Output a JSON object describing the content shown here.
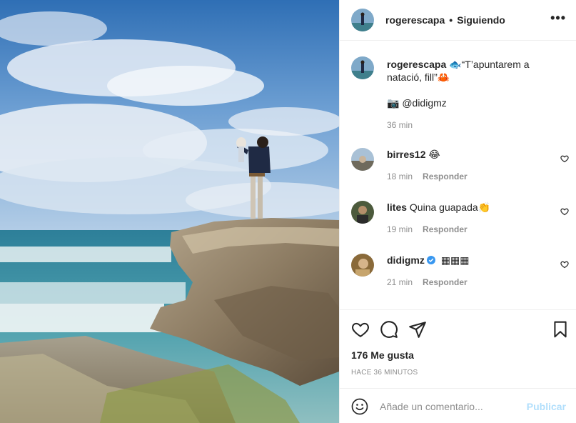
{
  "header": {
    "username": "rogerescapa",
    "separator": "•",
    "follow_status": "Siguiendo",
    "more_icon": "more-dots-icon"
  },
  "caption": {
    "username": "rogerescapa",
    "line1": "🐟“T’apuntarem a natació, fill”🦀",
    "line2": "📷 @didigmz",
    "time": "36 min"
  },
  "comments": [
    {
      "username": "birres12",
      "text": "😂",
      "time": "18 min",
      "reply": "Responder",
      "verified": false
    },
    {
      "username": "lites",
      "text": "Quina guapada👏",
      "time": "19 min",
      "reply": "Responder",
      "verified": false
    },
    {
      "username": "didigmz",
      "text": "▦▦▦",
      "time": "21 min",
      "reply": "Responder",
      "verified": true
    }
  ],
  "actions": {
    "likes": "176 Me gusta",
    "time_ago": "HACE 36 MINUTOS",
    "icons": [
      "heart-icon",
      "comment-icon",
      "share-icon",
      "bookmark-icon"
    ]
  },
  "add_comment": {
    "placeholder": "Añade un comentario...",
    "publish_label": "Publicar",
    "emoji_icon": "emoji-icon"
  },
  "colors": {
    "link_blue_disabled": "#b2dffc",
    "verified_blue": "#3897f0",
    "muted_text": "#8e8e8e"
  }
}
